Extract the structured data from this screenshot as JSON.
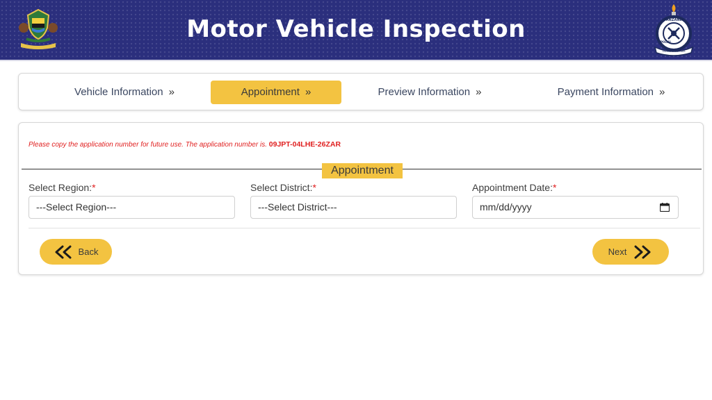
{
  "header": {
    "title": "Motor Vehicle Inspection",
    "left_emblem_icon": "coat-of-arms-icon",
    "right_emblem_icon": "police-badge-icon",
    "right_emblem_text_top": "TANZANIA",
    "right_emblem_text_side": "POLISI",
    "right_emblem_text_bottom": "USALAMA WA RAIA"
  },
  "steps": [
    {
      "label": "Vehicle Information",
      "active": false
    },
    {
      "label": "Appointment",
      "active": true
    },
    {
      "label": "Preview Information",
      "active": false
    },
    {
      "label": "Payment Information",
      "active": false
    }
  ],
  "step_chevron": "»",
  "notice": {
    "text": "Please copy the application number for future use. The application number is.",
    "application_number": "09JPT-04LHE-26ZAR"
  },
  "section": {
    "title": "Appointment"
  },
  "fields": {
    "region": {
      "label": "Select Region:",
      "required_mark": "*",
      "value": "---Select Region---"
    },
    "district": {
      "label": "Select District:",
      "required_mark": "*",
      "value": "---Select District---"
    },
    "date": {
      "label": "Appointment Date:",
      "required_mark": "*",
      "placeholder": "mm/dd/yyyy",
      "icon": "calendar-icon"
    }
  },
  "buttons": {
    "back": {
      "label": "Back",
      "icon": "double-chevron-left-icon"
    },
    "next": {
      "label": "Next",
      "icon": "double-chevron-right-icon"
    }
  },
  "colors": {
    "header_bg": "#2b2f7d",
    "accent": "#f3c341",
    "notice_red": "#e02020"
  }
}
